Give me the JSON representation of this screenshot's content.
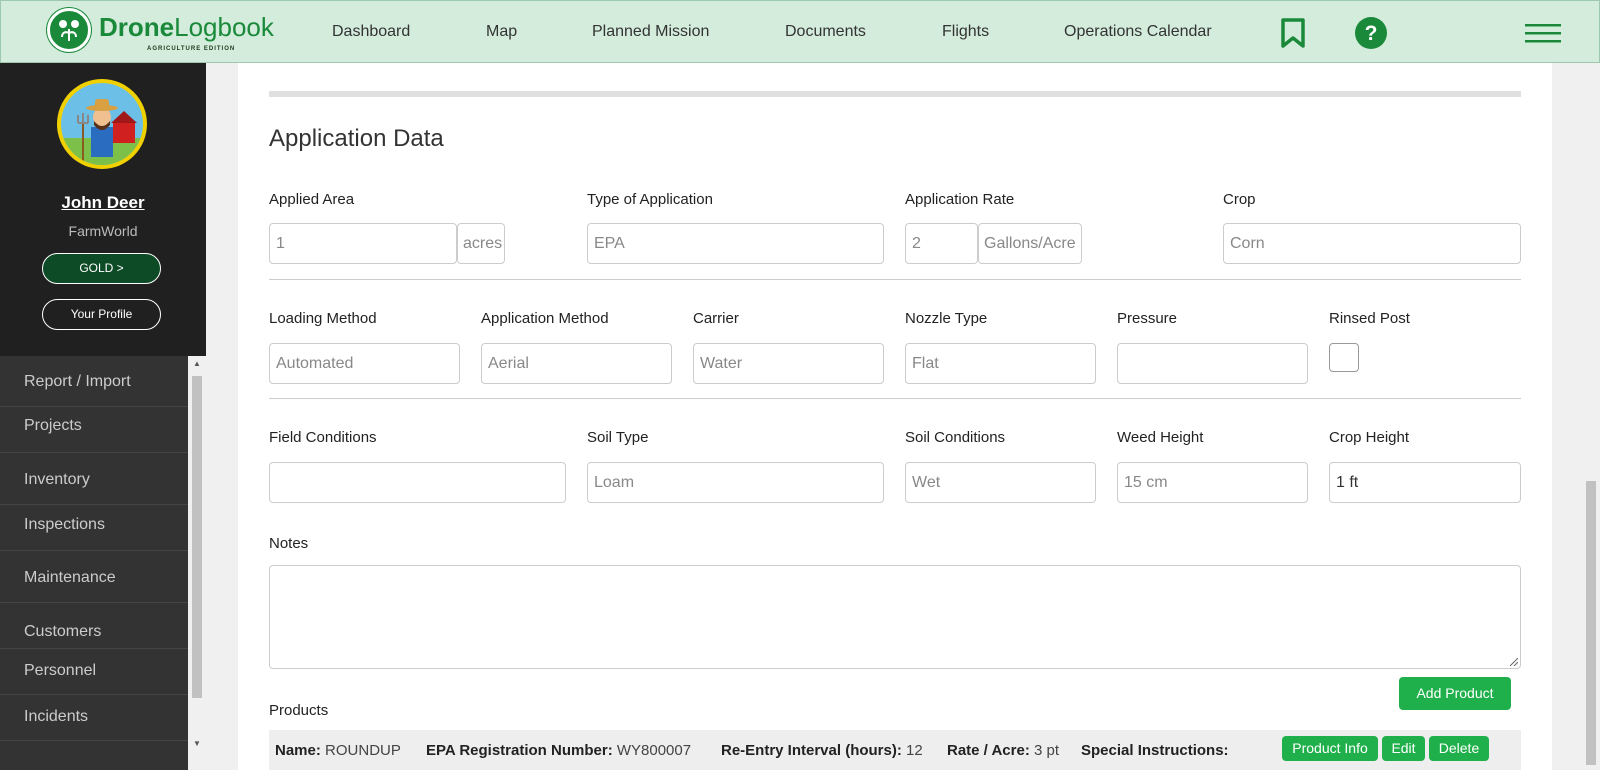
{
  "brand": {
    "name_bold": "Drone",
    "name_regular": "Logbook",
    "subtitle": "AGRICULTURE EDITION",
    "color": "#1a8a3a"
  },
  "nav": {
    "items": [
      "Dashboard",
      "Map",
      "Planned Mission",
      "Documents",
      "Flights",
      "Operations Calendar"
    ],
    "icons": [
      "bookmark-icon",
      "help-icon",
      "hamburger-menu-icon"
    ]
  },
  "sidebar": {
    "user_name": "John Deer",
    "org": "FarmWorld",
    "tier_button": "GOLD >",
    "profile_button": "Your Profile",
    "menu": [
      "Report / Import",
      "Projects",
      "Inventory",
      "Inspections",
      "Maintenance",
      "Customers",
      "Personnel",
      "Incidents"
    ]
  },
  "form": {
    "title": "Application Data",
    "applied_area": {
      "label": "Applied Area",
      "value": "1",
      "unit": "acres"
    },
    "type_of_application": {
      "label": "Type of Application",
      "placeholder": "EPA"
    },
    "application_rate": {
      "label": "Application Rate",
      "value": "2",
      "unit": "Gallons/Acre"
    },
    "crop": {
      "label": "Crop",
      "placeholder": "Corn"
    },
    "loading_method": {
      "label": "Loading Method",
      "placeholder": "Automated"
    },
    "application_method": {
      "label": "Application Method",
      "placeholder": "Aerial"
    },
    "carrier": {
      "label": "Carrier",
      "placeholder": "Water"
    },
    "nozzle_type": {
      "label": "Nozzle Type",
      "placeholder": "Flat"
    },
    "pressure": {
      "label": "Pressure",
      "value": ""
    },
    "rinsed_post": {
      "label": "Rinsed Post",
      "checked": false
    },
    "field_conditions": {
      "label": "Field Conditions",
      "value": ""
    },
    "soil_type": {
      "label": "Soil Type",
      "placeholder": "Loam"
    },
    "soil_conditions": {
      "label": "Soil Conditions",
      "placeholder": "Wet"
    },
    "weed_height": {
      "label": "Weed Height",
      "placeholder": "15 cm"
    },
    "crop_height": {
      "label": "Crop Height",
      "value": "1 ft"
    },
    "notes": {
      "label": "Notes",
      "value": ""
    }
  },
  "products": {
    "label": "Products",
    "add_button": "Add Product",
    "rows": [
      {
        "name_label": "Name:",
        "name": "ROUNDUP",
        "epa_label": "EPA Registration Number:",
        "epa": "WY800007",
        "reentry_label": "Re-Entry Interval (hours):",
        "reentry": "12",
        "rate_label": "Rate / Acre:",
        "rate": "3 pt",
        "instructions_label": "Special Instructions:",
        "instructions": "",
        "info_button": "Product Info",
        "edit_button": "Edit",
        "delete_button": "Delete"
      }
    ]
  },
  "colors": {
    "nav_bg": "#d3ecdc",
    "sidebar_bg": "#202020",
    "button_green": "#1fb04b"
  }
}
